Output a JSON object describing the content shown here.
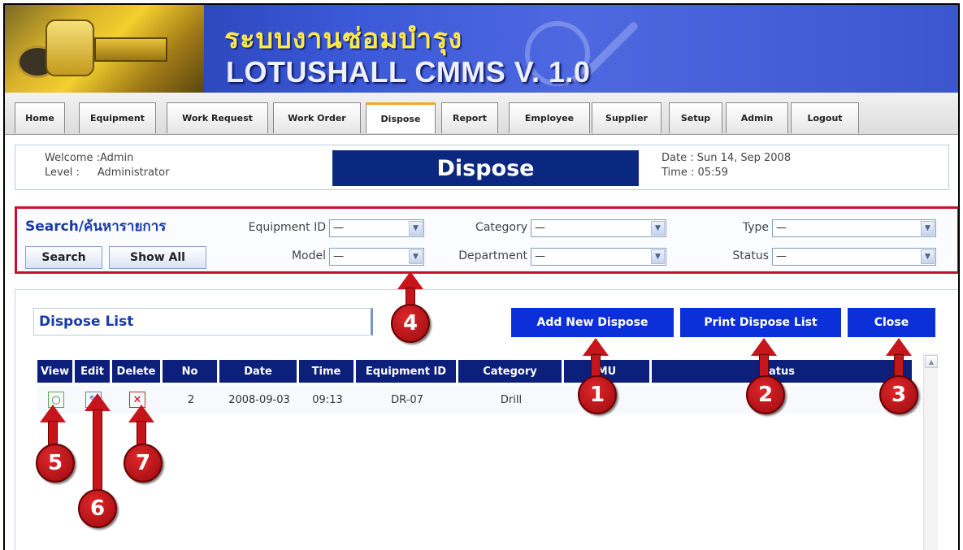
{
  "banner": {
    "title_th": "ระบบงานซ่อมบำรุง",
    "title_en": "LOTUSHALL CMMS V. 1.0"
  },
  "nav": {
    "tabs": [
      {
        "label": "Home"
      },
      {
        "label": "Equipment"
      },
      {
        "label": "Work Request"
      },
      {
        "label": "Work Order"
      },
      {
        "label": "Dispose",
        "active": true
      },
      {
        "label": "Report"
      },
      {
        "label": "Employee"
      },
      {
        "label": "Supplier"
      },
      {
        "label": "Setup"
      },
      {
        "label": "Admin"
      },
      {
        "label": "Logout"
      }
    ]
  },
  "welcome": {
    "welcome_text": "Welcome :Admin",
    "level_label": "Level :",
    "level_value": "Administrator",
    "page_heading": "Dispose",
    "date_text": "Date : Sun 14, Sep 2008",
    "time_text": "Time : 05:59"
  },
  "search": {
    "title": "Search/ค้นหารายการ",
    "search_button": "Search",
    "show_all_button": "Show All",
    "fields": {
      "equipment_id": {
        "label": "Equipment ID",
        "value": "—"
      },
      "category": {
        "label": "Category",
        "value": "—"
      },
      "type": {
        "label": "Type",
        "value": "—"
      },
      "model": {
        "label": "Model",
        "value": "—"
      },
      "department": {
        "label": "Department",
        "value": "—"
      },
      "status": {
        "label": "Status",
        "value": "—"
      }
    }
  },
  "list": {
    "title": "Dispose List",
    "add_button": "Add New Dispose",
    "print_button": "Print Dispose List",
    "close_button": "Close",
    "columns": [
      "View",
      "Edit",
      "Delete",
      "No",
      "Date",
      "Time",
      "Equipment ID",
      "Category",
      "MU",
      "atus"
    ],
    "rows": [
      {
        "no": "2",
        "date": "2008-09-03",
        "time": "09:13",
        "equipment_id": "DR-07",
        "category": "Drill"
      }
    ]
  },
  "callouts": [
    "1",
    "2",
    "3",
    "4",
    "5",
    "6",
    "7"
  ],
  "colors": {
    "accent_blue": "#0b2fd8",
    "header_navy": "#0c1f7a",
    "callout_red": "#c6161c",
    "search_border": "#c8102e"
  },
  "icons": {
    "view": "magnifier-icon",
    "edit": "pencil-icon",
    "delete": "delete-x-icon"
  }
}
